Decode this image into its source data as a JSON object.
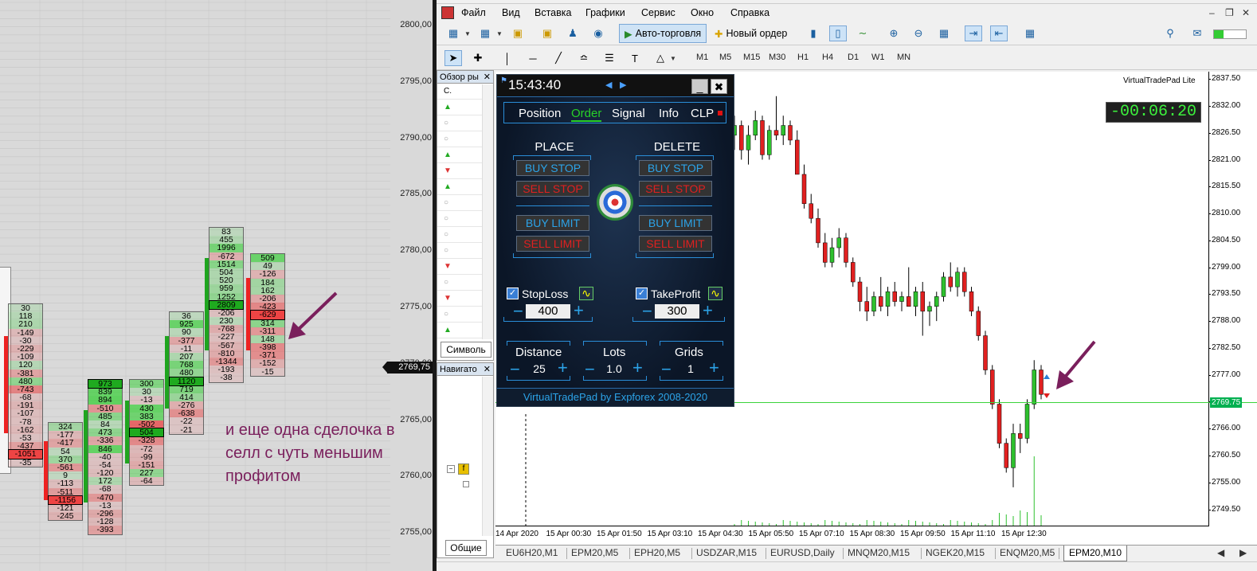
{
  "footprint": {
    "price_labels": [
      "2800,00",
      "2795,00",
      "2790,00",
      "2785,00",
      "2780,00",
      "2775,00",
      "2770,00",
      "2765,00",
      "2760,00",
      "2755,00"
    ],
    "current_price": "2769,75",
    "annotation": "и еще одна сделочка в селл с чуть меньшим профитом",
    "colors": {
      "positive": "#3fcf3f",
      "negative": "#e33"
    },
    "columns": [
      {
        "cells": [],
        "bar": "red",
        "note": "partial left column"
      },
      {
        "cells": [
          "30",
          "118",
          "210",
          "-149",
          "-30",
          "-229",
          "-109",
          "120",
          "-381",
          "480",
          "-743",
          "-68",
          "-191",
          "-107",
          "-78",
          "-162",
          "-53",
          "-437",
          "-1051",
          "-35"
        ],
        "bar": "red"
      },
      {
        "cells": [
          "324",
          "-177",
          "-417",
          "54",
          "370",
          "-561",
          "9",
          "-113",
          "-511",
          "-1156",
          "-121",
          "-245"
        ],
        "bar": "red"
      },
      {
        "cells": [
          "973",
          "839",
          "894",
          "-510",
          "485",
          "84",
          "473",
          "-336",
          "846",
          "-40",
          "-54",
          "-120",
          "172",
          "-68",
          "-470",
          "-13",
          "-296",
          "-128",
          "-393"
        ],
        "bar": "green"
      },
      {
        "cells": [
          "300",
          "30",
          "-13",
          "430",
          "383",
          "-502",
          "504",
          "-328",
          "-72",
          "-99",
          "-151",
          "227",
          "-64"
        ],
        "bar": "green"
      },
      {
        "cells": [
          "36",
          "925",
          "90",
          "-377",
          "-11",
          "207",
          "768",
          "480",
          "1120",
          "719",
          "414",
          "-276",
          "-638",
          "-22",
          "-21"
        ],
        "bar": "green"
      },
      {
        "cells": [
          "83",
          "455",
          "1996",
          "-672",
          "1514",
          "504",
          "520",
          "959",
          "1252",
          "2809",
          "-206",
          "230",
          "-768",
          "-227",
          "-567",
          "-810",
          "-1344",
          "-193",
          "-38"
        ],
        "bar": "green"
      },
      {
        "cells": [
          "509",
          "49",
          "-126",
          "184",
          "162",
          "-206",
          "-423",
          "-629",
          "314",
          "-311",
          "148",
          "-398",
          "-371",
          "-152",
          "-15"
        ],
        "bar": "red"
      }
    ]
  },
  "terminal": {
    "menu": [
      "Файл",
      "Вид",
      "Вставка",
      "Графики",
      "Сервис",
      "Окно",
      "Справка"
    ],
    "toolbar": {
      "autotrade": "Авто-торговля",
      "new_order": "Новый ордер"
    },
    "timeframes": [
      "M1",
      "M5",
      "M15",
      "M30",
      "H1",
      "H4",
      "D1",
      "W1",
      "MN"
    ],
    "market_watch": {
      "title": "Обзор ры",
      "col": "С.",
      "tab": "Символь"
    },
    "navigator": {
      "title": "Навигато",
      "tab": "Общие"
    },
    "chart": {
      "vtp_label": "VirtualTradePad  Lite",
      "timer": "-00:06:20",
      "current_price": "2769.75",
      "price_labels": [
        "2837.50",
        "2832.00",
        "2826.50",
        "2821.00",
        "2815.50",
        "2810.00",
        "2804.50",
        "2799.00",
        "2793.50",
        "2788.00",
        "2782.50",
        "2777.00",
        "2771.50",
        "2766.00",
        "2760.50",
        "2755.00",
        "2749.50"
      ],
      "time_labels": [
        "14 Apr 2020",
        "15 Apr 00:30",
        "15 Apr 01:50",
        "15 Apr 03:10",
        "15 Apr 04:30",
        "15 Apr 05:50",
        "15 Apr 07:10",
        "15 Apr 08:30",
        "15 Apr 09:50",
        "15 Apr 11:10",
        "15 Apr 12:30"
      ],
      "candles": [
        {
          "o": 2826,
          "h": 2830,
          "l": 2823,
          "c": 2828
        },
        {
          "o": 2828,
          "h": 2829,
          "l": 2821,
          "c": 2823
        },
        {
          "o": 2823,
          "h": 2828,
          "l": 2820,
          "c": 2826
        },
        {
          "o": 2826,
          "h": 2831,
          "l": 2825,
          "c": 2829
        },
        {
          "o": 2829,
          "h": 2830,
          "l": 2821,
          "c": 2822
        },
        {
          "o": 2822,
          "h": 2828,
          "l": 2821,
          "c": 2827
        },
        {
          "o": 2827,
          "h": 2834,
          "l": 2825,
          "c": 2826
        },
        {
          "o": 2826,
          "h": 2830,
          "l": 2824,
          "c": 2828
        },
        {
          "o": 2828,
          "h": 2829,
          "l": 2824,
          "c": 2825
        },
        {
          "o": 2825,
          "h": 2827,
          "l": 2818,
          "c": 2818
        },
        {
          "o": 2818,
          "h": 2820,
          "l": 2811,
          "c": 2812
        },
        {
          "o": 2812,
          "h": 2814,
          "l": 2808,
          "c": 2809
        },
        {
          "o": 2809,
          "h": 2811,
          "l": 2803,
          "c": 2804
        },
        {
          "o": 2804,
          "h": 2806,
          "l": 2799,
          "c": 2800
        },
        {
          "o": 2800,
          "h": 2805,
          "l": 2799,
          "c": 2803
        },
        {
          "o": 2803,
          "h": 2807,
          "l": 2801,
          "c": 2805
        },
        {
          "o": 2805,
          "h": 2806,
          "l": 2799,
          "c": 2800
        },
        {
          "o": 2800,
          "h": 2801,
          "l": 2795,
          "c": 2796
        },
        {
          "o": 2796,
          "h": 2797,
          "l": 2790,
          "c": 2792
        },
        {
          "o": 2792,
          "h": 2795,
          "l": 2788,
          "c": 2790
        },
        {
          "o": 2790,
          "h": 2794,
          "l": 2789,
          "c": 2793
        },
        {
          "o": 2793,
          "h": 2797,
          "l": 2790,
          "c": 2791
        },
        {
          "o": 2791,
          "h": 2795,
          "l": 2789,
          "c": 2794
        },
        {
          "o": 2794,
          "h": 2796,
          "l": 2791,
          "c": 2792
        },
        {
          "o": 2792,
          "h": 2794,
          "l": 2790,
          "c": 2793
        },
        {
          "o": 2793,
          "h": 2799,
          "l": 2791,
          "c": 2791
        },
        {
          "o": 2791,
          "h": 2795,
          "l": 2789,
          "c": 2794
        },
        {
          "o": 2794,
          "h": 2796,
          "l": 2785,
          "c": 2790
        },
        {
          "o": 2790,
          "h": 2792,
          "l": 2787,
          "c": 2791
        },
        {
          "o": 2791,
          "h": 2794,
          "l": 2788,
          "c": 2793
        },
        {
          "o": 2793,
          "h": 2798,
          "l": 2792,
          "c": 2797
        },
        {
          "o": 2797,
          "h": 2800,
          "l": 2794,
          "c": 2795
        },
        {
          "o": 2795,
          "h": 2799,
          "l": 2793,
          "c": 2798
        },
        {
          "o": 2798,
          "h": 2799,
          "l": 2793,
          "c": 2794
        },
        {
          "o": 2794,
          "h": 2795,
          "l": 2789,
          "c": 2790
        },
        {
          "o": 2790,
          "h": 2791,
          "l": 2784,
          "c": 2785
        },
        {
          "o": 2785,
          "h": 2786,
          "l": 2777,
          "c": 2778
        },
        {
          "o": 2778,
          "h": 2779,
          "l": 2770,
          "c": 2771
        },
        {
          "o": 2771,
          "h": 2772,
          "l": 2762,
          "c": 2763
        },
        {
          "o": 2763,
          "h": 2764,
          "l": 2757,
          "c": 2758
        },
        {
          "o": 2758,
          "h": 2767,
          "l": 2754,
          "c": 2765
        },
        {
          "o": 2765,
          "h": 2767,
          "l": 2761,
          "c": 2764
        },
        {
          "o": 2764,
          "h": 2772,
          "l": 2763,
          "c": 2771
        },
        {
          "o": 2771,
          "h": 2780,
          "l": 2770,
          "c": 2778
        },
        {
          "o": 2778,
          "h": 2779,
          "l": 2772,
          "c": 2773
        }
      ]
    },
    "vtp": {
      "time": "15:43:40",
      "tabs": [
        "Position",
        "Order",
        "Signal",
        "Info",
        "CLP"
      ],
      "active_tab": "Order",
      "place": "PLACE",
      "delete": "DELETE",
      "buy_stop": "BUY STOP",
      "sell_stop": "SELL STOP",
      "buy_limit": "BUY LIMIT",
      "sell_limit": "SELL LIMIT",
      "stoploss_label": "StopLoss",
      "stoploss": "400",
      "takeprofit_label": "TakeProfit",
      "takeprofit": "300",
      "distance_label": "Distance",
      "distance": "25",
      "lots_label": "Lots",
      "lots": "1.0",
      "grids_label": "Grids",
      "grids": "1",
      "footer": "VirtualTradePad by Expforex 2008-2020"
    },
    "tabs": [
      "EU6H20,M1",
      "EPM20,M5",
      "EPH20,M5",
      "USDZAR,M15",
      "EURUSD,Daily",
      "MNQM20,M15",
      "NGEK20,M15",
      "ENQM20,M5",
      "EPM20,M10"
    ],
    "active_tab": "EPM20,M10"
  }
}
